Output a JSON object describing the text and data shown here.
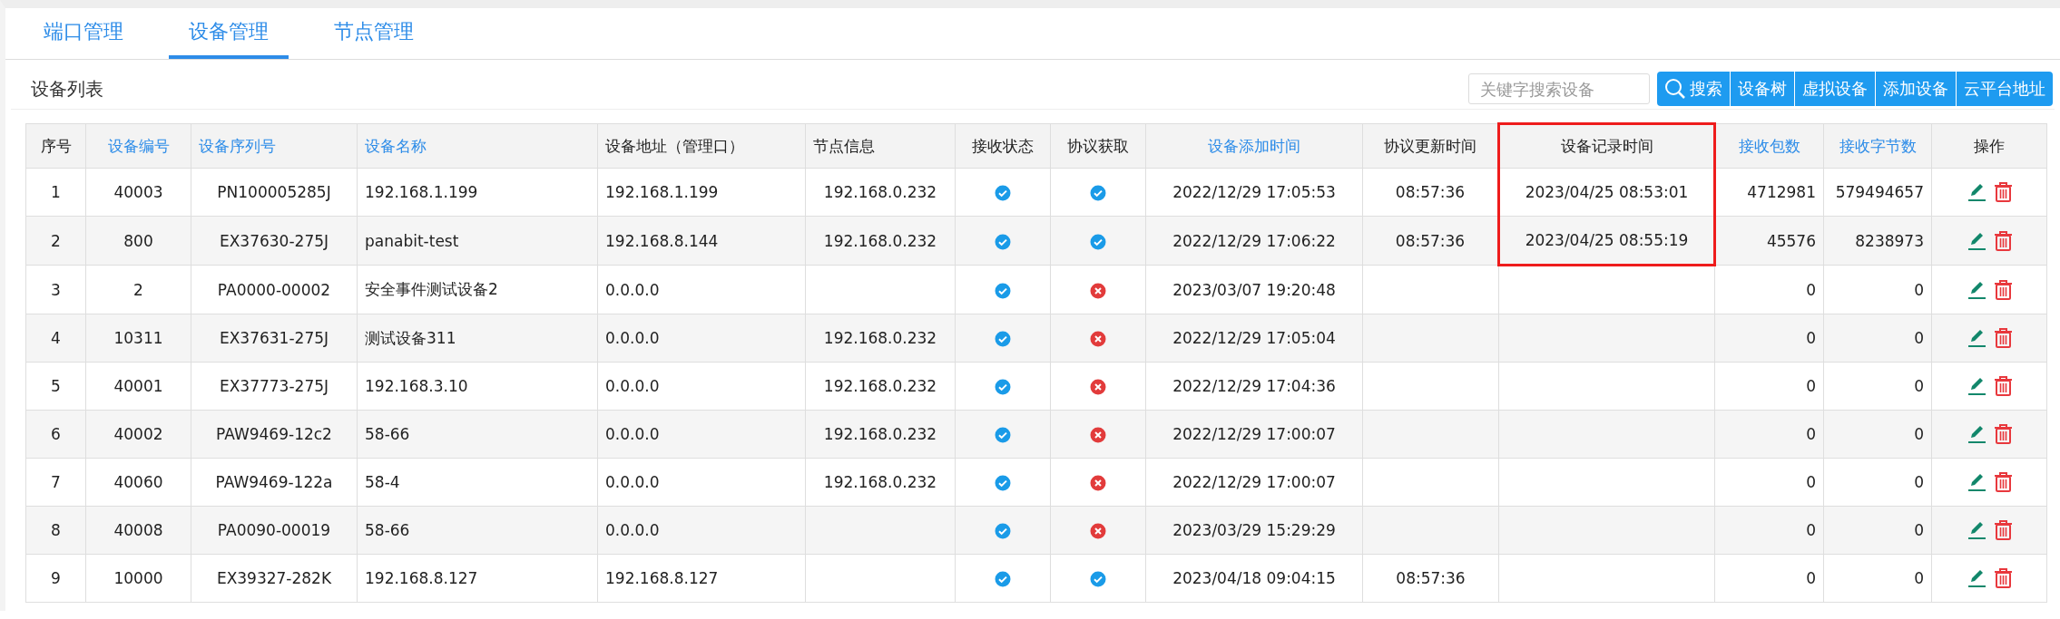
{
  "tabs": [
    {
      "label": "端口管理",
      "selected": false
    },
    {
      "label": "设备管理",
      "selected": true
    },
    {
      "label": "节点管理",
      "selected": false
    }
  ],
  "panel": {
    "title": "设备列表"
  },
  "search": {
    "placeholder": "关键字搜索设备"
  },
  "buttons": [
    {
      "label": "搜索",
      "kind": "search"
    },
    {
      "label": "设备树",
      "kind": "plain"
    },
    {
      "label": "虚拟设备",
      "kind": "plain"
    },
    {
      "label": "添加设备",
      "kind": "plain"
    },
    {
      "label": "云平台地址",
      "kind": "plain"
    }
  ],
  "table": {
    "columns": [
      {
        "label": "序号",
        "sortable": false,
        "highlighted": false
      },
      {
        "label": "设备编号",
        "sortable": true,
        "highlighted": false
      },
      {
        "label": "设备序列号",
        "sortable": true,
        "highlighted": false
      },
      {
        "label": "设备名称",
        "sortable": true,
        "highlighted": false
      },
      {
        "label": "设备地址（管理口）",
        "sortable": false,
        "highlighted": false
      },
      {
        "label": "节点信息",
        "sortable": false,
        "highlighted": false
      },
      {
        "label": "接收状态",
        "sortable": false,
        "highlighted": false
      },
      {
        "label": "协议获取",
        "sortable": false,
        "highlighted": false
      },
      {
        "label": "设备添加时间",
        "sortable": true,
        "highlighted": false
      },
      {
        "label": "协议更新时间",
        "sortable": false,
        "highlighted": false
      },
      {
        "label": "设备记录时间",
        "sortable": false,
        "highlighted": true
      },
      {
        "label": "接收包数",
        "sortable": true,
        "highlighted": false
      },
      {
        "label": "接收字节数",
        "sortable": true,
        "highlighted": false
      },
      {
        "label": "操作",
        "sortable": false,
        "highlighted": false
      }
    ],
    "rows": [
      {
        "no": "1",
        "id": "40003",
        "serial": "PN100005285J",
        "name": "192.168.1.199",
        "address": "192.168.1.199",
        "node": "192.168.0.232",
        "received": true,
        "protocol": true,
        "added": "2022/12/29 17:05:53",
        "updated": "08:57:36",
        "recorded": "2023/04/25 08:53:01",
        "packets": "4712981",
        "bytes": "579494657",
        "highlighted": true
      },
      {
        "no": "2",
        "id": "800",
        "serial": "EX37630-275J",
        "name": "panabit-test",
        "address": "192.168.8.144",
        "node": "192.168.0.232",
        "received": true,
        "protocol": true,
        "added": "2022/12/29 17:06:22",
        "updated": "08:57:36",
        "recorded": "2023/04/25 08:55:19",
        "packets": "45576",
        "bytes": "8238973",
        "highlighted": true
      },
      {
        "no": "3",
        "id": "2",
        "serial": "PA0000-00002",
        "name": "安全事件测试设备2",
        "address": "0.0.0.0",
        "received": true,
        "protocol": false,
        "added": "2023/03/07 19:20:48",
        "packets": "0",
        "bytes": "0",
        "highlighted": false
      },
      {
        "no": "4",
        "id": "10311",
        "serial": "EX37631-275J",
        "name": "测试设备311",
        "address": "0.0.0.0",
        "node": "192.168.0.232",
        "received": true,
        "protocol": false,
        "added": "2022/12/29 17:05:04",
        "packets": "0",
        "bytes": "0",
        "highlighted": false
      },
      {
        "no": "5",
        "id": "40001",
        "serial": "EX37773-275J",
        "name": "192.168.3.10",
        "address": "0.0.0.0",
        "node": "192.168.0.232",
        "received": true,
        "protocol": false,
        "added": "2022/12/29 17:04:36",
        "packets": "0",
        "bytes": "0",
        "highlighted": false
      },
      {
        "no": "6",
        "id": "40002",
        "serial": "PAW9469-12c2",
        "name": "58-66",
        "address": "0.0.0.0",
        "node": "192.168.0.232",
        "received": true,
        "protocol": false,
        "added": "2022/12/29 17:00:07",
        "packets": "0",
        "bytes": "0",
        "highlighted": false
      },
      {
        "no": "7",
        "id": "40060",
        "serial": "PAW9469-122a",
        "name": "58-4",
        "address": "0.0.0.0",
        "node": "192.168.0.232",
        "received": true,
        "protocol": false,
        "added": "2022/12/29 17:00:07",
        "packets": "0",
        "bytes": "0",
        "highlighted": false
      },
      {
        "no": "8",
        "id": "40008",
        "serial": "PA0090-00019",
        "name": "58-66",
        "address": "0.0.0.0",
        "received": true,
        "protocol": false,
        "added": "2023/03/29 15:29:29",
        "packets": "0",
        "bytes": "0",
        "highlighted": false
      },
      {
        "no": "9",
        "id": "10000",
        "serial": "EX39327-282K",
        "name": "192.168.8.127",
        "address": "192.168.8.127",
        "received": true,
        "protocol": true,
        "added": "2023/04/18 09:04:15",
        "updated": "08:57:36",
        "packets": "0",
        "bytes": "0",
        "highlighted": false
      }
    ]
  }
}
